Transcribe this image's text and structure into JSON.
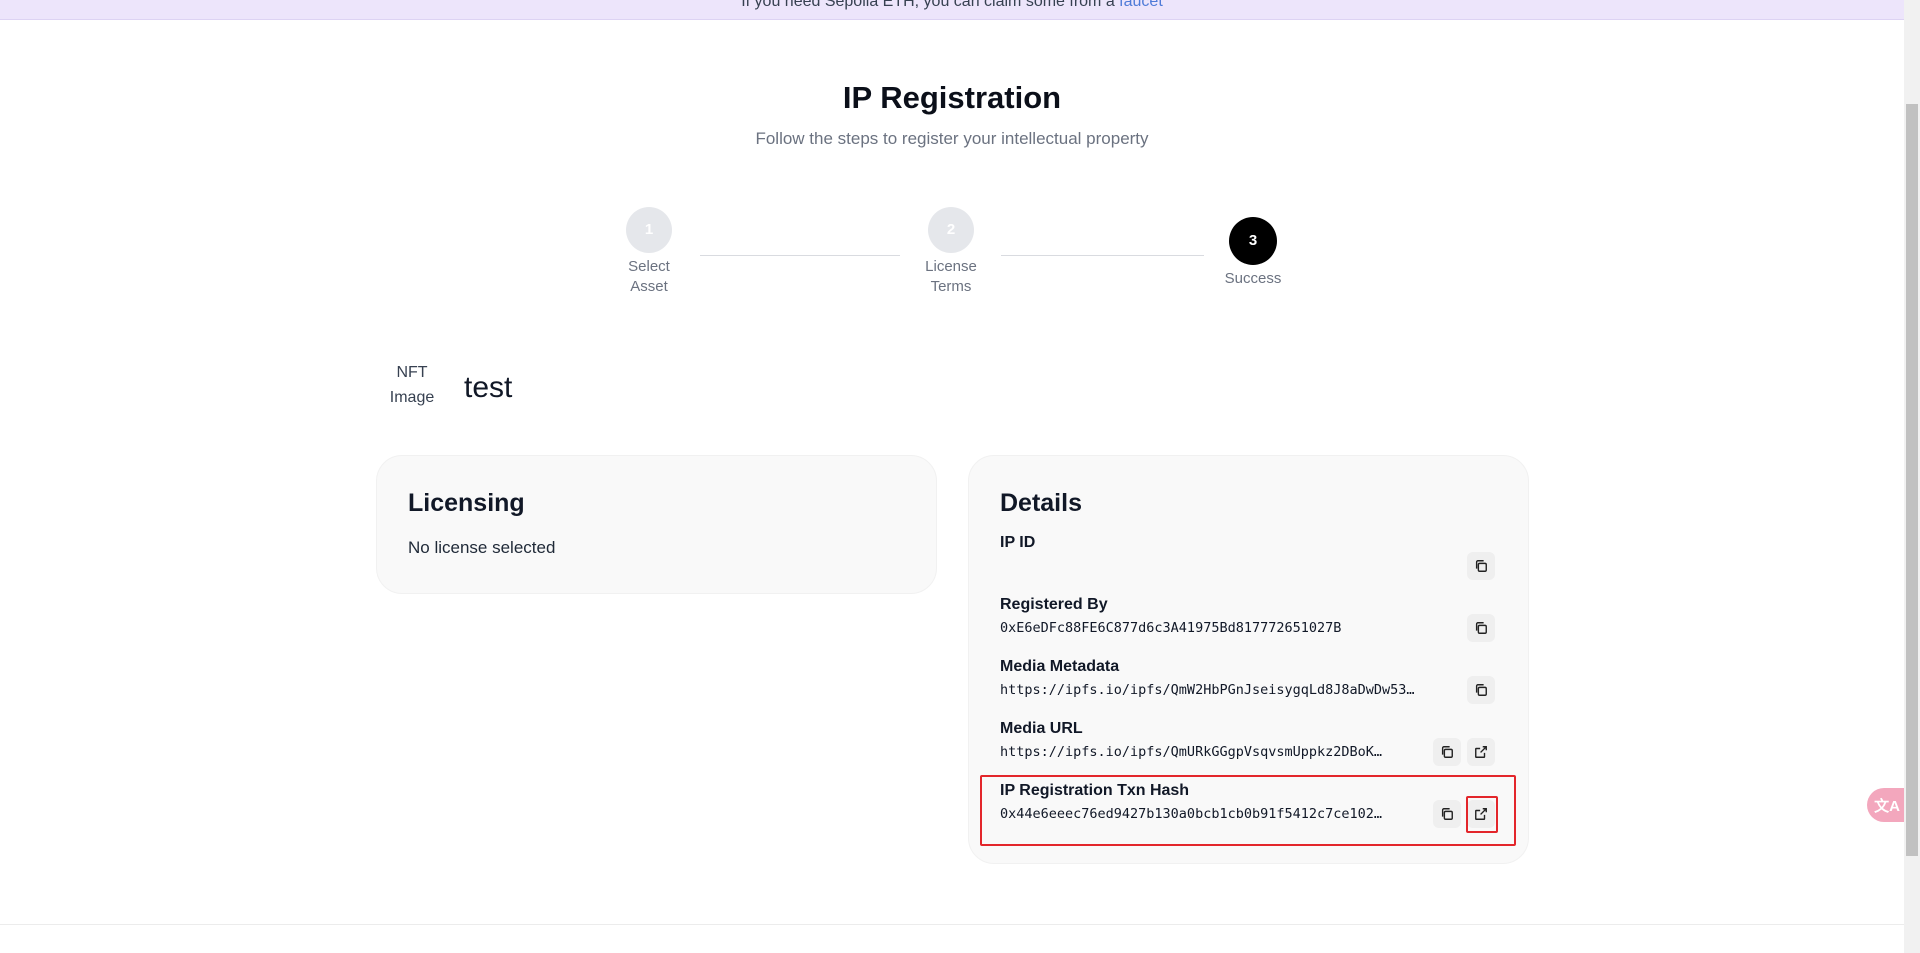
{
  "banner": {
    "text": "If you need Sepolia ETH, you can claim some from a ",
    "link": "faucet"
  },
  "header": {
    "title": "IP Registration",
    "subtitle": "Follow the steps to register your intellectual property"
  },
  "steps": [
    {
      "number": "1",
      "label": "Select Asset"
    },
    {
      "number": "2",
      "label": "License Terms"
    },
    {
      "number": "3",
      "label": "Success"
    }
  ],
  "nft": {
    "image_alt": "NFT Image",
    "name": "test"
  },
  "licensing": {
    "title": "Licensing",
    "text": "No license selected"
  },
  "details": {
    "title": "Details",
    "rows": [
      {
        "label": "IP ID",
        "value": ""
      },
      {
        "label": "Registered By",
        "value": "0xE6eDFc88FE6C877d6c3A41975Bd817772651027B"
      },
      {
        "label": "Media Metadata",
        "value": "https://ipfs.io/ipfs/QmW2HbPGnJseisygqLd8J8aDwDw53…"
      },
      {
        "label": "Media URL",
        "value": "https://ipfs.io/ipfs/QmURkGGgpVsqvsmUppkz2DBoK…"
      },
      {
        "label": "IP Registration Txn Hash",
        "value": "0x44e6eeec76ed9427b130a0bcb1cb0b91f5412c7ce102…"
      }
    ]
  },
  "colors": {
    "banner_bg": "#ede5fb",
    "link": "#4f7bd8",
    "active_step": "#000000",
    "highlight": "#e3262b"
  },
  "icons": {
    "copy": "copy-icon",
    "external": "external-link-icon",
    "translate": "translate-icon"
  },
  "translate_glyph": "文A"
}
